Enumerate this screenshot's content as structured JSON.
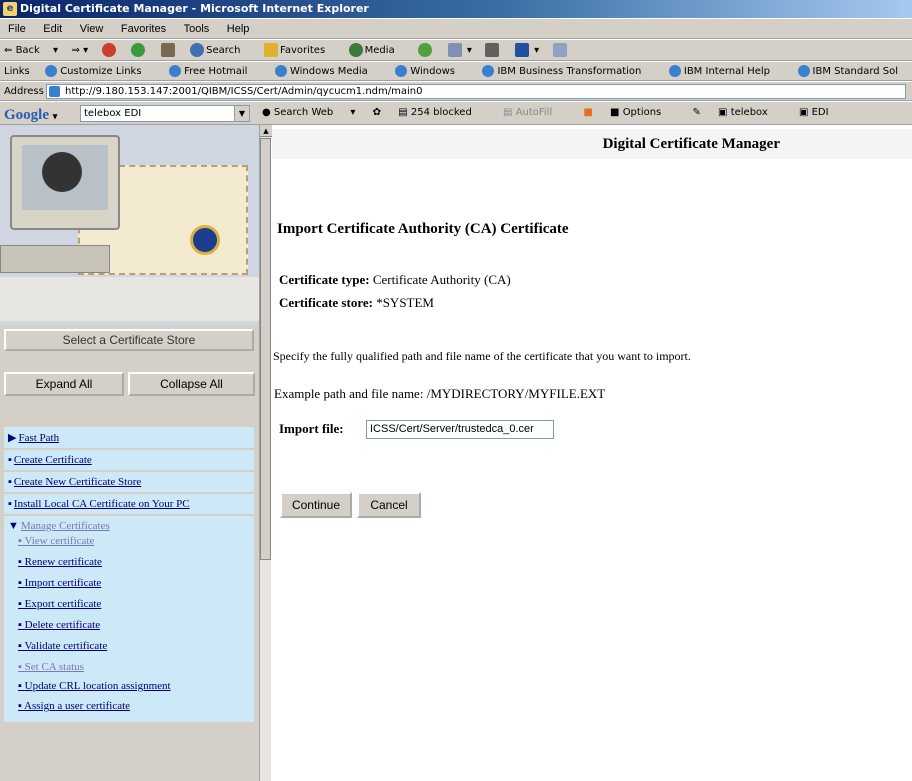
{
  "window": {
    "title": "Digital Certificate Manager - Microsoft Internet Explorer"
  },
  "menu": [
    "File",
    "Edit",
    "View",
    "Favorites",
    "Tools",
    "Help"
  ],
  "toolbar": {
    "back": "Back",
    "search": "Search",
    "favorites": "Favorites",
    "media": "Media"
  },
  "links": {
    "label": "Links",
    "items": [
      "Customize Links",
      "Free Hotmail",
      "Windows Media",
      "Windows",
      "IBM Business Transformation",
      "IBM Internal Help",
      "IBM Standard Sol"
    ]
  },
  "address": {
    "label": "Address",
    "url": "http://9.180.153.147:2001/QIBM/ICSS/Cert/Admin/qycucm1.ndm/main0"
  },
  "google": {
    "logo": "Google",
    "query": "telebox EDI",
    "search_web": "Search Web",
    "blocked": "254 blocked",
    "autofill": "AutoFill",
    "options": "Options",
    "telebox": "telebox",
    "edi": "EDI"
  },
  "sidebar": {
    "select_store": "Select a Certificate Store",
    "expand_all": "Expand All",
    "collapse_all": "Collapse All",
    "items": [
      "Fast Path",
      "Create Certificate",
      "Create New Certificate Store",
      "Install Local CA Certificate on Your PC",
      "Manage Certificates"
    ],
    "sub_items": [
      "View certificate",
      "Renew certificate",
      "Import certificate",
      "Export certificate",
      "Delete certificate",
      "Validate certificate",
      "Set CA status",
      "Update CRL location assignment",
      "Assign a user certificate"
    ]
  },
  "main": {
    "header": "Digital Certificate Manager",
    "heading": "Import Certificate Authority (CA) Certificate",
    "cert_type_label": "Certificate type:",
    "cert_type_value": "Certificate Authority (CA)",
    "cert_store_label": "Certificate store:",
    "cert_store_value": "*SYSTEM",
    "instructions": "Specify the fully qualified path and file name of the certificate that you want to import.",
    "example_label": "Example path and file name:",
    "example_value": "/MYDIRECTORY/MYFILE.EXT",
    "import_file_label": "Import file:",
    "import_file_value": "ICSS/Cert/Server/trustedca_0.cer",
    "continue": "Continue",
    "cancel": "Cancel"
  }
}
